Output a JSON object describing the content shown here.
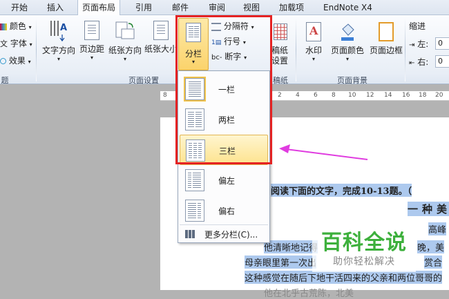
{
  "tabs": [
    {
      "label": "开始"
    },
    {
      "label": "插入"
    },
    {
      "label": "页面布局"
    },
    {
      "label": "引用"
    },
    {
      "label": "邮件"
    },
    {
      "label": "审阅"
    },
    {
      "label": "视图"
    },
    {
      "label": "加载项"
    },
    {
      "label": "EndNote X4"
    }
  ],
  "ribbon": {
    "theme": {
      "colors": "颜色",
      "fonts": "字体",
      "effects": "效果",
      "group_tail": "题"
    },
    "page_setup": {
      "text_direction": "文字方向",
      "margins": "页边距",
      "orientation": "纸张方向",
      "size": "纸张大小",
      "columns": "分栏",
      "breaks": "分隔符",
      "line_numbers": "行号",
      "hyphenation": "断字",
      "group_label": "页面设置"
    },
    "draft": {
      "label_top": "稿纸",
      "label_bottom": "设置",
      "group_label": "稿纸"
    },
    "background": {
      "watermark": "水印",
      "page_color": "页面颜色",
      "page_borders": "页面边框",
      "group_label": "页面背景"
    },
    "paragraph": {
      "indent": "缩进",
      "left": "左:",
      "right": "右:",
      "left_value": "0",
      "right_value": "0"
    }
  },
  "columns_menu": {
    "items": [
      {
        "label": "一栏"
      },
      {
        "label": "两栏"
      },
      {
        "label": "三栏"
      },
      {
        "label": "偏左"
      },
      {
        "label": "偏右"
      }
    ],
    "more": "更多分栏(C)..."
  },
  "ruler_marks": [
    "8",
    "2",
    "4",
    "6",
    "8",
    "10",
    "12",
    "14",
    "16",
    "18",
    "20"
  ],
  "document": {
    "line1": "阅读下面的文字，完成10-13题。（",
    "line2": "一种美",
    "line3": "高峰",
    "line4a": "他清晰地记得",
    "line4b": "晚，美",
    "line5a": "母亲眼里第一次出",
    "line5b": "赏合",
    "line6": "这种感觉在随后下地干活四来的父亲和两位哥哥的",
    "line7": "他在北乎古荒陈，北美"
  },
  "watermark": {
    "title": "百科全说",
    "subtitle": "助你轻松解决"
  },
  "colors": {
    "accent": "#fbd36b",
    "highlight_box": "#e52222",
    "arrow": "#e03ce0",
    "selection": "#adc9ee",
    "watermark_green": "#3db03c"
  }
}
